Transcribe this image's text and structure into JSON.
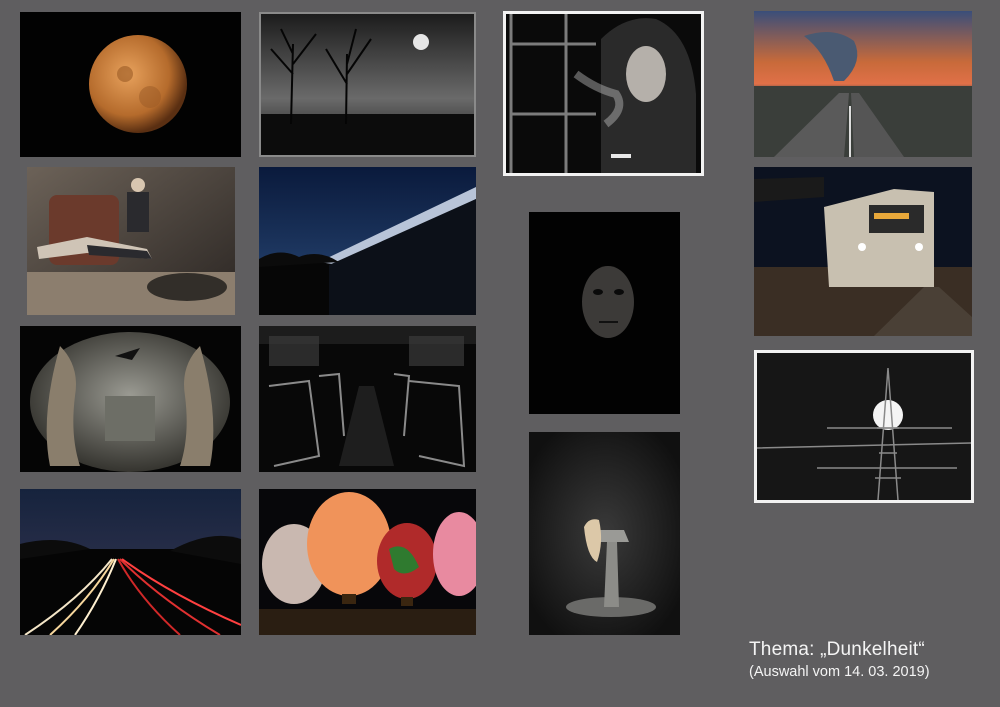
{
  "caption": {
    "title": "Thema: „Dunkelheit“",
    "subtitle": "(Auswahl vom 14. 03. 2019)"
  }
}
